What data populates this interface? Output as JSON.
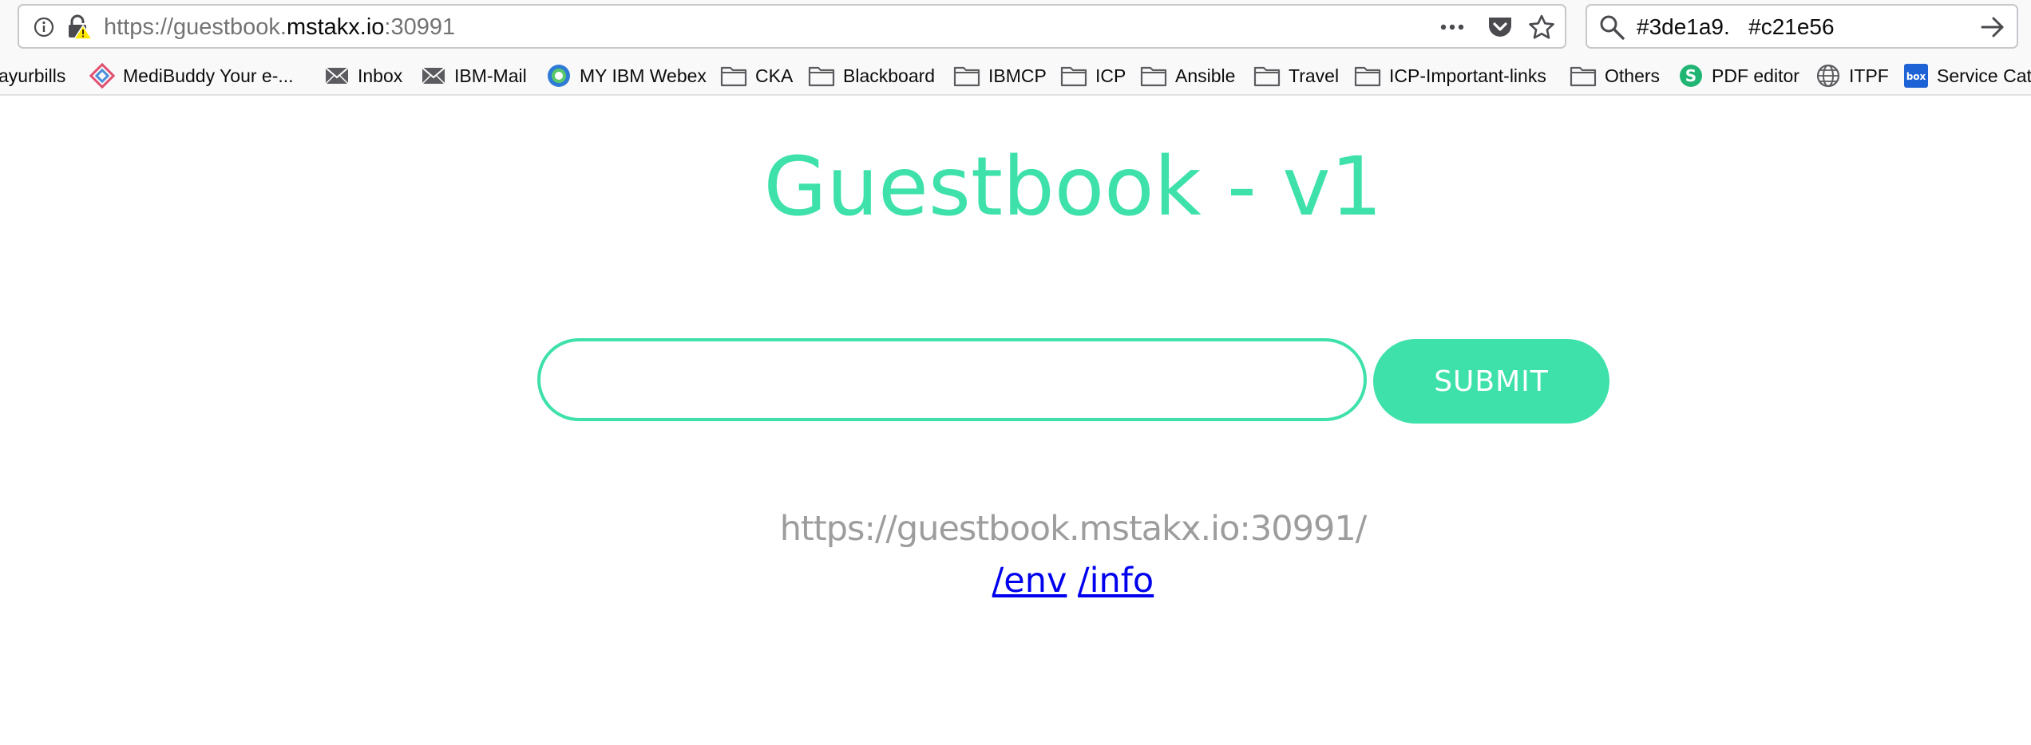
{
  "browser": {
    "url_prefix": "https://guestbook.",
    "url_host": "mstakx.io",
    "url_suffix": ":30991",
    "search_value": "#3de1a9.   #c21e56"
  },
  "bookmarks": [
    {
      "label": "ayurbills",
      "icon": "none"
    },
    {
      "label": "MediBuddy Your e-...",
      "icon": "medibuddy-icon"
    },
    {
      "label": "Inbox",
      "icon": "mail-icon"
    },
    {
      "label": "IBM-Mail",
      "icon": "mail-icon"
    },
    {
      "label": "MY IBM Webex",
      "icon": "webex-icon"
    },
    {
      "label": "CKA",
      "icon": "folder-icon"
    },
    {
      "label": "Blackboard",
      "icon": "folder-icon"
    },
    {
      "label": "IBMCP",
      "icon": "folder-icon"
    },
    {
      "label": "ICP",
      "icon": "folder-icon"
    },
    {
      "label": "Ansible",
      "icon": "folder-icon"
    },
    {
      "label": "Travel",
      "icon": "folder-icon"
    },
    {
      "label": "ICP-Important-links",
      "icon": "folder-icon"
    },
    {
      "label": "Others",
      "icon": "folder-icon"
    },
    {
      "label": "PDF editor",
      "icon": "pdf-editor-icon"
    },
    {
      "label": "ITPF",
      "icon": "globe-icon"
    },
    {
      "label": "Service Cat",
      "icon": "box-icon"
    }
  ],
  "page": {
    "title": "Guestbook - v1",
    "input_value": "",
    "submit_label": "SUBMIT",
    "host_address": "https://guestbook.mstakx.io:30991/",
    "env_link": "/env",
    "info_link": "/info"
  },
  "colors": {
    "accent": "#3de1a9",
    "link": "#0000ee",
    "muted_text": "#9d9d9d"
  }
}
